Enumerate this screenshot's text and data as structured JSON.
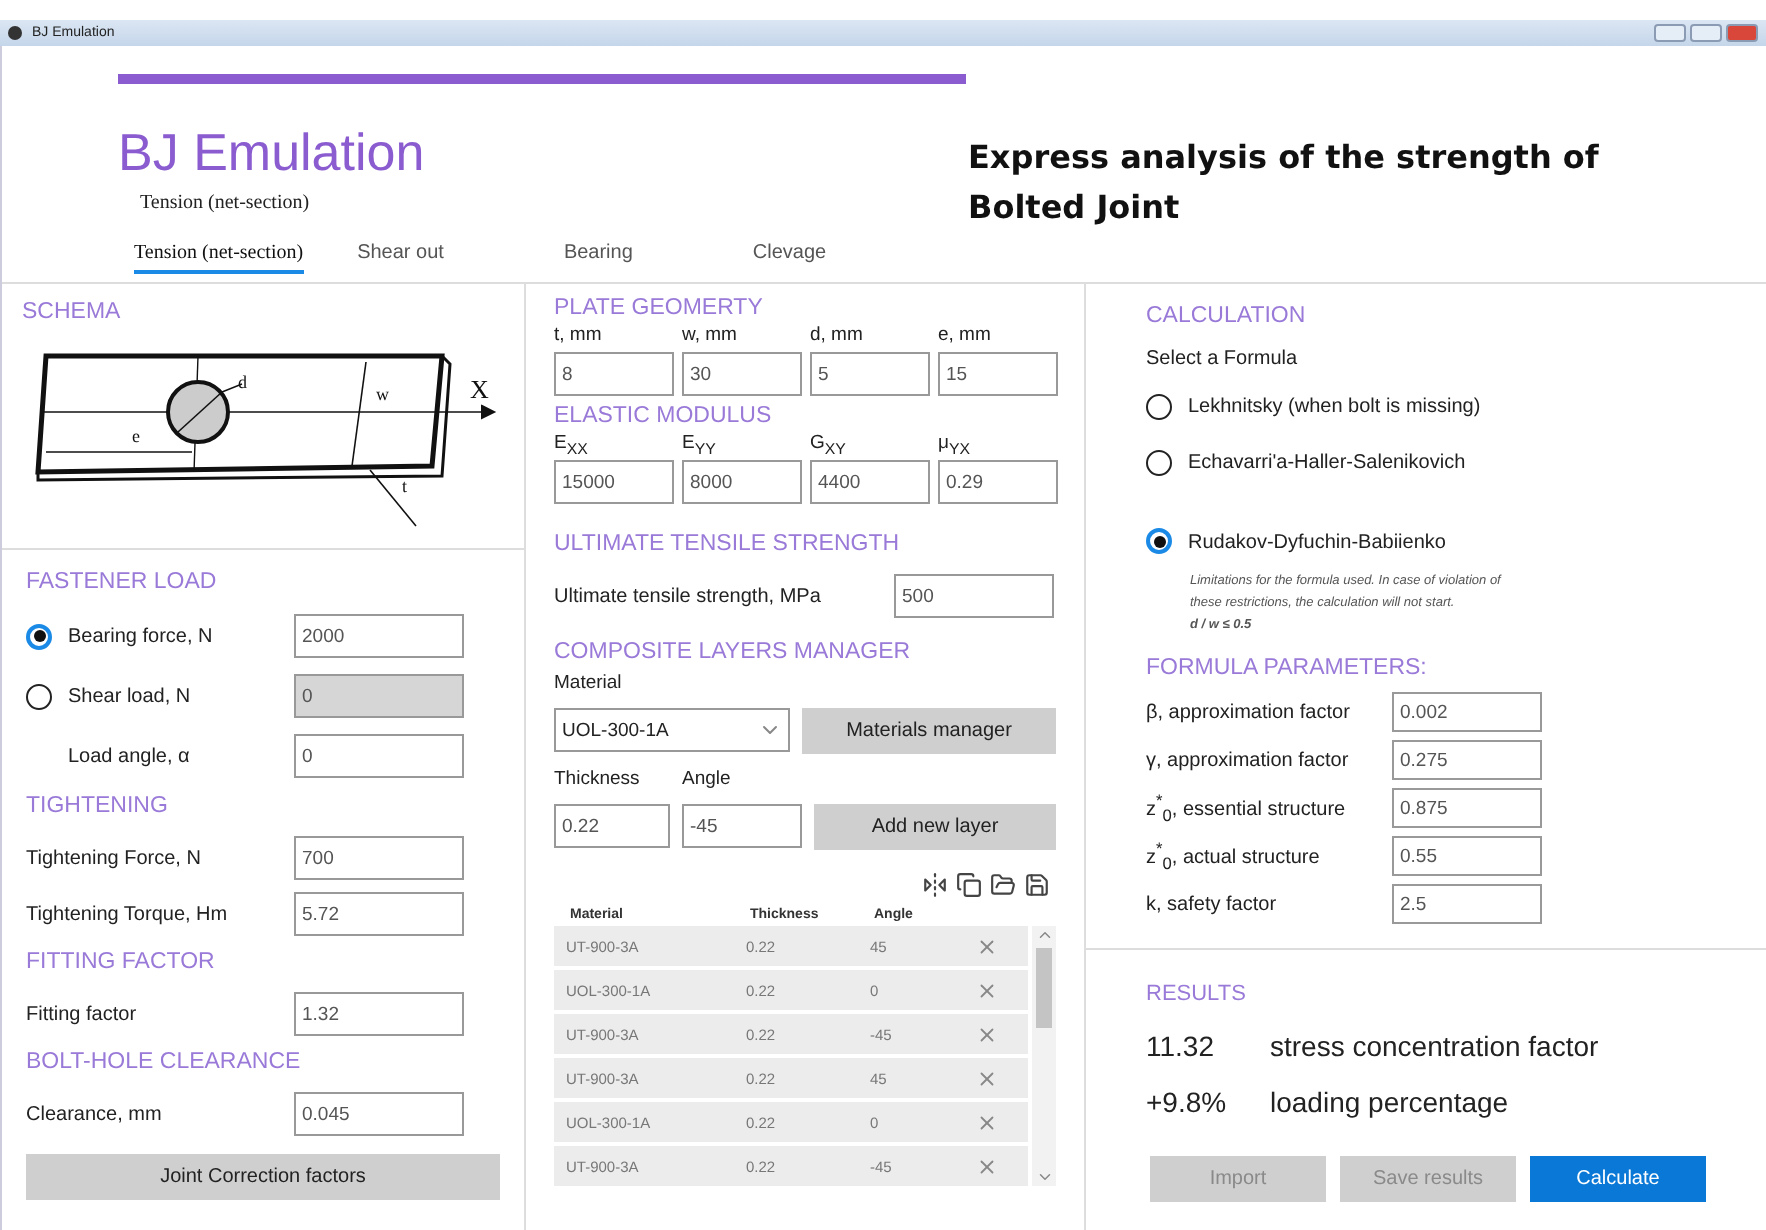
{
  "window": {
    "title": "BJ Emulation"
  },
  "header": {
    "app_title": "BJ Emulation",
    "subtitle": "Tension (net-section)",
    "heading_lines": [
      "Express analysis of the strength of",
      "Bolted Joint"
    ]
  },
  "tabs": [
    {
      "label": "Tension (net-section)",
      "selected": true
    },
    {
      "label": "Shear out",
      "selected": false
    },
    {
      "label": "Bearing",
      "selected": false
    },
    {
      "label": "Clevage",
      "selected": false
    }
  ],
  "schema": {
    "title": "SCHEMA",
    "labels": [
      "d",
      "w",
      "e",
      "t",
      "X"
    ]
  },
  "fastener_load": {
    "title": "FASTENER LOAD",
    "rows": [
      {
        "kind": "radio",
        "label": "Bearing force, N",
        "selected": true,
        "value": "2000",
        "disabled": false
      },
      {
        "kind": "radio",
        "label": "Shear load, N",
        "selected": false,
        "value": "0",
        "disabled": true
      },
      {
        "kind": "plain",
        "label": "Load angle, α",
        "value": "0",
        "disabled": false
      }
    ]
  },
  "tightening": {
    "title": "TIGHTENING",
    "rows": [
      {
        "label": "Tightening Force, N",
        "value": "700"
      },
      {
        "label": "Tightening Torque, Hm",
        "value": "5.72"
      }
    ]
  },
  "fitting": {
    "title": "FITTING FACTOR",
    "rows": [
      {
        "label": "Fitting factor",
        "value": "1.32"
      }
    ]
  },
  "clearance": {
    "title": "BOLT-HOLE CLEARANCE",
    "rows": [
      {
        "label": "Clearance, mm",
        "value": "0.045"
      }
    ]
  },
  "correction_button": "Joint Correction factors",
  "plate_geometry": {
    "title": "PLATE GEOMERTY",
    "fields": [
      {
        "label": "t, mm",
        "value": "8"
      },
      {
        "label": "w, mm",
        "value": "30"
      },
      {
        "label": "d, mm",
        "value": "5"
      },
      {
        "label": "e, mm",
        "value": "15"
      }
    ]
  },
  "elastic_modulus": {
    "title": "ELASTIC MODULUS",
    "fields": [
      {
        "label": "E$_{XX}$",
        "value": "15000"
      },
      {
        "label": "E$_{YY}$",
        "value": "8000"
      },
      {
        "label": "G$_{XY}$",
        "value": "4400"
      },
      {
        "label": "μ$_{YX}$",
        "value": "0.29"
      }
    ]
  },
  "uts": {
    "title": "ULTIMATE TENSILE STRENGTH",
    "label": "Ultimate tensile strength, MPa",
    "value": "500"
  },
  "layers": {
    "title": "COMPOSITE LAYERS MANAGER",
    "material_label": "Material",
    "material_value": "UOL-300-1A",
    "materials_button": "Materials manager",
    "thickness_label": "Thickness",
    "thickness_value": "0.22",
    "angle_label": "Angle",
    "angle_value": "-45",
    "add_button": "Add new layer",
    "columns": [
      "Material",
      "Thickness",
      "Angle"
    ],
    "rows": [
      {
        "material": "UT-900-3A",
        "thickness": "0.22",
        "angle": "45"
      },
      {
        "material": "UOL-300-1A",
        "thickness": "0.22",
        "angle": "0"
      },
      {
        "material": "UT-900-3A",
        "thickness": "0.22",
        "angle": "-45"
      },
      {
        "material": "UT-900-3A",
        "thickness": "0.22",
        "angle": "45"
      },
      {
        "material": "UOL-300-1A",
        "thickness": "0.22",
        "angle": "0"
      },
      {
        "material": "UT-900-3A",
        "thickness": "0.22",
        "angle": "-45"
      }
    ]
  },
  "calculation": {
    "title": "CALCULATION",
    "prompt": "Select a Formula",
    "formulas": [
      {
        "label": "Lekhnitsky (when bolt is missing)",
        "selected": false
      },
      {
        "label": "Echavarri'a-Haller-Salenikovich",
        "selected": false
      },
      {
        "label": "Rudakov-Dyfuchin-Babiienko",
        "selected": true
      }
    ],
    "note_lines": [
      "Limitations for the formula used. In case of violation of",
      "these restrictions, the calculation will not start.",
      "d / w ≤ 0.5"
    ]
  },
  "formula_parameters": {
    "title": "FORMULA PARAMETERS:",
    "rows": [
      {
        "label": "β, approximation factor",
        "value": "0.002"
      },
      {
        "label": "γ, approximation factor",
        "value": "0.275"
      },
      {
        "label": "z$^{*}$$_{0}$, essential structure",
        "value": "0.875"
      },
      {
        "label": "z$^{*}$$_{0}$, actual structure",
        "value": "0.55"
      },
      {
        "label": "k, safety factor",
        "value": "2.5"
      }
    ]
  },
  "results": {
    "title": "RESULTS",
    "rows": [
      {
        "value": "11.32",
        "label": "stress concentration factor"
      },
      {
        "value": "+9.8%",
        "label": "loading percentage"
      }
    ]
  },
  "buttons": [
    {
      "label": "Import",
      "kind": "secondary",
      "disabled": true
    },
    {
      "label": "Save results",
      "kind": "secondary",
      "disabled": true
    },
    {
      "label": "Calculate",
      "kind": "primary",
      "disabled": false
    }
  ]
}
